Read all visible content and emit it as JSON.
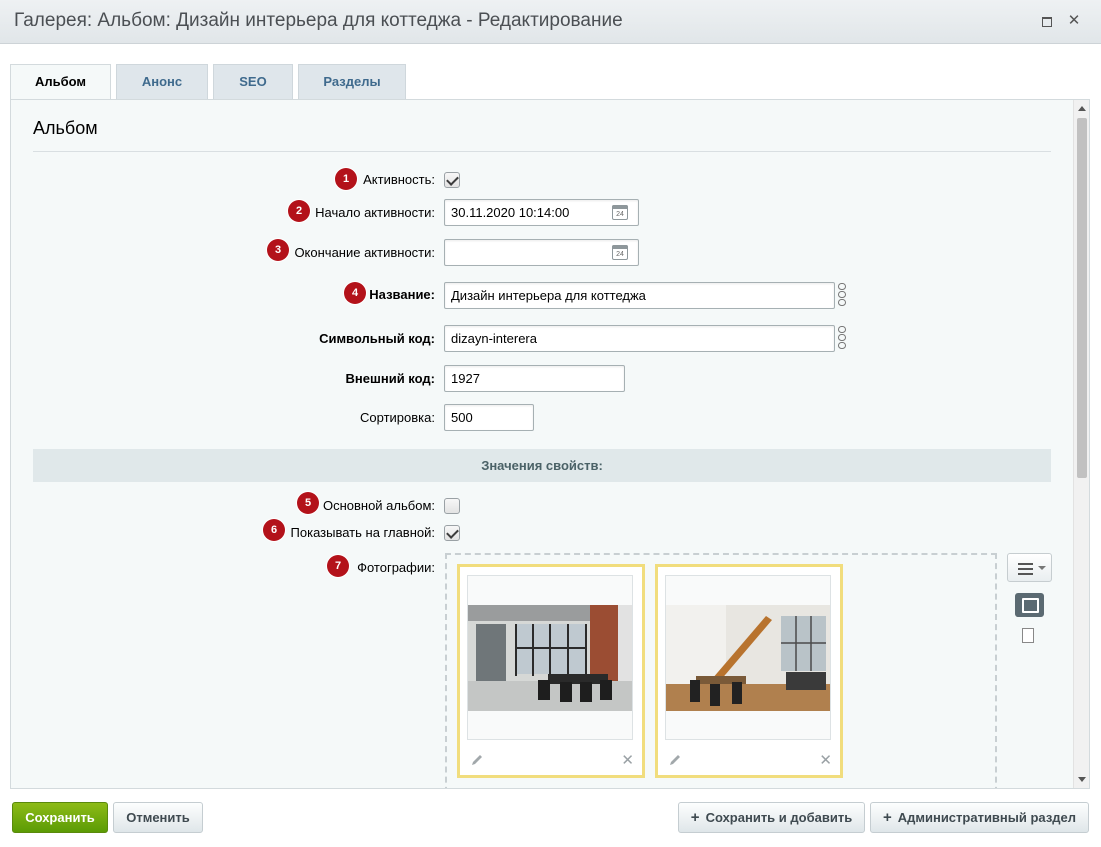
{
  "window": {
    "title": "Галерея: Альбом: Дизайн интерьера для коттеджа - Редактирование",
    "close_glyph": "✕"
  },
  "tabs": [
    {
      "label": "Альбом",
      "active": true
    },
    {
      "label": "Анонс",
      "active": false
    },
    {
      "label": "SEO",
      "active": false
    },
    {
      "label": "Разделы",
      "active": false
    }
  ],
  "section": {
    "title": "Альбом"
  },
  "form": {
    "active": {
      "badge": "1",
      "label": "Активность:",
      "checked": true
    },
    "start": {
      "badge": "2",
      "label": "Начало активности:",
      "value": "30.11.2020 10:14:00"
    },
    "end": {
      "badge": "3",
      "label": "Окончание активности:",
      "value": ""
    },
    "name": {
      "badge": "4",
      "label": "Название:",
      "value": "Дизайн интерьера для коттеджа"
    },
    "code": {
      "label": "Символьный код:",
      "value": "dizayn-interera"
    },
    "xml_id": {
      "label": "Внешний код:",
      "value": "1927"
    },
    "sort": {
      "label": "Сортировка:",
      "value": "500"
    },
    "calendar_day": "24"
  },
  "properties": {
    "title": "Значения свойств:",
    "main_album": {
      "badge": "5",
      "label": "Основной альбом:",
      "checked": false
    },
    "show_main": {
      "badge": "6",
      "label": "Показывать на главной:",
      "checked": true
    },
    "photos": {
      "badge": "7",
      "label": "Фотографии:"
    }
  },
  "photos": [
    {
      "alt": "office-interior-photo",
      "delete_glyph": "✕"
    },
    {
      "alt": "loft-interior-photo",
      "delete_glyph": "✕"
    }
  ],
  "footer": {
    "save": "Сохранить",
    "cancel": "Отменить",
    "save_add": "Сохранить и добавить",
    "admin_section": "Административный раздел",
    "plus_glyph": "+"
  },
  "colors": {
    "badge": "#b3121a",
    "save_button": "#6ea70b",
    "photo_border": "#f1dd7d"
  }
}
